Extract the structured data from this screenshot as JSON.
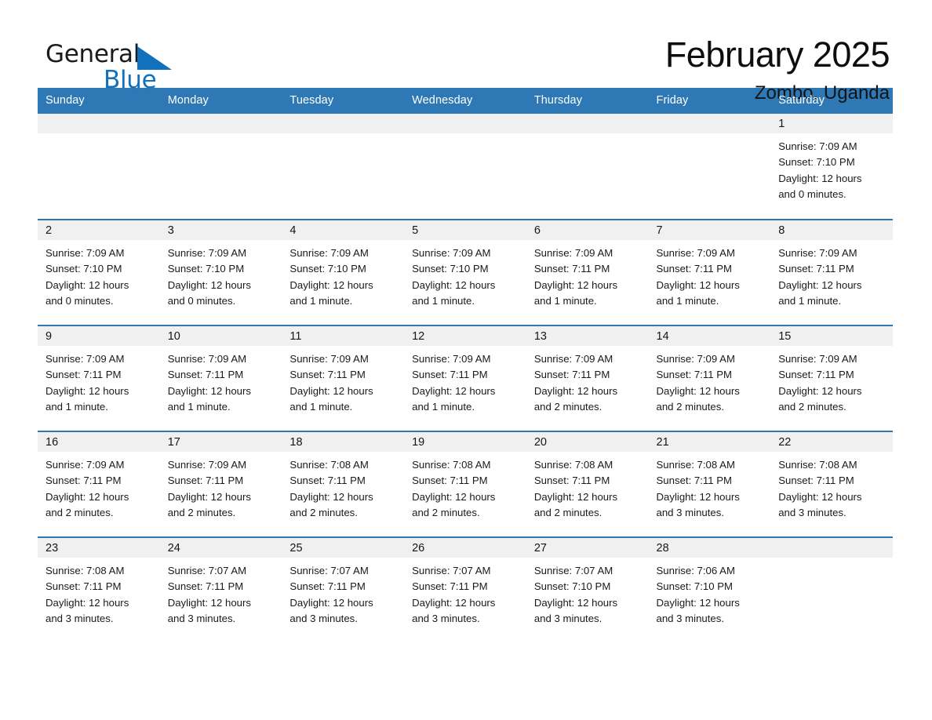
{
  "brand": {
    "name_part1": "General",
    "name_part2": "Blue",
    "triangle_color": "#1271ba"
  },
  "header": {
    "title": "February 2025",
    "location": "Zombo, Uganda"
  },
  "theme": {
    "header_blue": "#2e79b5",
    "daynum_band": "#f0f0f0",
    "text": "#1a1a1a"
  },
  "weekday_headers": [
    "Sunday",
    "Monday",
    "Tuesday",
    "Wednesday",
    "Thursday",
    "Friday",
    "Saturday"
  ],
  "weeks": [
    [
      {
        "day": "",
        "sunrise": "",
        "sunset": "",
        "daylight_line1": "",
        "daylight_line2": "",
        "empty": true
      },
      {
        "day": "",
        "sunrise": "",
        "sunset": "",
        "daylight_line1": "",
        "daylight_line2": "",
        "empty": true
      },
      {
        "day": "",
        "sunrise": "",
        "sunset": "",
        "daylight_line1": "",
        "daylight_line2": "",
        "empty": true
      },
      {
        "day": "",
        "sunrise": "",
        "sunset": "",
        "daylight_line1": "",
        "daylight_line2": "",
        "empty": true
      },
      {
        "day": "",
        "sunrise": "",
        "sunset": "",
        "daylight_line1": "",
        "daylight_line2": "",
        "empty": true
      },
      {
        "day": "",
        "sunrise": "",
        "sunset": "",
        "daylight_line1": "",
        "daylight_line2": "",
        "empty": true
      },
      {
        "day": "1",
        "sunrise": "Sunrise: 7:09 AM",
        "sunset": "Sunset: 7:10 PM",
        "daylight_line1": "Daylight: 12 hours",
        "daylight_line2": "and 0 minutes.",
        "empty": false
      }
    ],
    [
      {
        "day": "2",
        "sunrise": "Sunrise: 7:09 AM",
        "sunset": "Sunset: 7:10 PM",
        "daylight_line1": "Daylight: 12 hours",
        "daylight_line2": "and 0 minutes.",
        "empty": false
      },
      {
        "day": "3",
        "sunrise": "Sunrise: 7:09 AM",
        "sunset": "Sunset: 7:10 PM",
        "daylight_line1": "Daylight: 12 hours",
        "daylight_line2": "and 0 minutes.",
        "empty": false
      },
      {
        "day": "4",
        "sunrise": "Sunrise: 7:09 AM",
        "sunset": "Sunset: 7:10 PM",
        "daylight_line1": "Daylight: 12 hours",
        "daylight_line2": "and 1 minute.",
        "empty": false
      },
      {
        "day": "5",
        "sunrise": "Sunrise: 7:09 AM",
        "sunset": "Sunset: 7:10 PM",
        "daylight_line1": "Daylight: 12 hours",
        "daylight_line2": "and 1 minute.",
        "empty": false
      },
      {
        "day": "6",
        "sunrise": "Sunrise: 7:09 AM",
        "sunset": "Sunset: 7:11 PM",
        "daylight_line1": "Daylight: 12 hours",
        "daylight_line2": "and 1 minute.",
        "empty": false
      },
      {
        "day": "7",
        "sunrise": "Sunrise: 7:09 AM",
        "sunset": "Sunset: 7:11 PM",
        "daylight_line1": "Daylight: 12 hours",
        "daylight_line2": "and 1 minute.",
        "empty": false
      },
      {
        "day": "8",
        "sunrise": "Sunrise: 7:09 AM",
        "sunset": "Sunset: 7:11 PM",
        "daylight_line1": "Daylight: 12 hours",
        "daylight_line2": "and 1 minute.",
        "empty": false
      }
    ],
    [
      {
        "day": "9",
        "sunrise": "Sunrise: 7:09 AM",
        "sunset": "Sunset: 7:11 PM",
        "daylight_line1": "Daylight: 12 hours",
        "daylight_line2": "and 1 minute.",
        "empty": false
      },
      {
        "day": "10",
        "sunrise": "Sunrise: 7:09 AM",
        "sunset": "Sunset: 7:11 PM",
        "daylight_line1": "Daylight: 12 hours",
        "daylight_line2": "and 1 minute.",
        "empty": false
      },
      {
        "day": "11",
        "sunrise": "Sunrise: 7:09 AM",
        "sunset": "Sunset: 7:11 PM",
        "daylight_line1": "Daylight: 12 hours",
        "daylight_line2": "and 1 minute.",
        "empty": false
      },
      {
        "day": "12",
        "sunrise": "Sunrise: 7:09 AM",
        "sunset": "Sunset: 7:11 PM",
        "daylight_line1": "Daylight: 12 hours",
        "daylight_line2": "and 1 minute.",
        "empty": false
      },
      {
        "day": "13",
        "sunrise": "Sunrise: 7:09 AM",
        "sunset": "Sunset: 7:11 PM",
        "daylight_line1": "Daylight: 12 hours",
        "daylight_line2": "and 2 minutes.",
        "empty": false
      },
      {
        "day": "14",
        "sunrise": "Sunrise: 7:09 AM",
        "sunset": "Sunset: 7:11 PM",
        "daylight_line1": "Daylight: 12 hours",
        "daylight_line2": "and 2 minutes.",
        "empty": false
      },
      {
        "day": "15",
        "sunrise": "Sunrise: 7:09 AM",
        "sunset": "Sunset: 7:11 PM",
        "daylight_line1": "Daylight: 12 hours",
        "daylight_line2": "and 2 minutes.",
        "empty": false
      }
    ],
    [
      {
        "day": "16",
        "sunrise": "Sunrise: 7:09 AM",
        "sunset": "Sunset: 7:11 PM",
        "daylight_line1": "Daylight: 12 hours",
        "daylight_line2": "and 2 minutes.",
        "empty": false
      },
      {
        "day": "17",
        "sunrise": "Sunrise: 7:09 AM",
        "sunset": "Sunset: 7:11 PM",
        "daylight_line1": "Daylight: 12 hours",
        "daylight_line2": "and 2 minutes.",
        "empty": false
      },
      {
        "day": "18",
        "sunrise": "Sunrise: 7:08 AM",
        "sunset": "Sunset: 7:11 PM",
        "daylight_line1": "Daylight: 12 hours",
        "daylight_line2": "and 2 minutes.",
        "empty": false
      },
      {
        "day": "19",
        "sunrise": "Sunrise: 7:08 AM",
        "sunset": "Sunset: 7:11 PM",
        "daylight_line1": "Daylight: 12 hours",
        "daylight_line2": "and 2 minutes.",
        "empty": false
      },
      {
        "day": "20",
        "sunrise": "Sunrise: 7:08 AM",
        "sunset": "Sunset: 7:11 PM",
        "daylight_line1": "Daylight: 12 hours",
        "daylight_line2": "and 2 minutes.",
        "empty": false
      },
      {
        "day": "21",
        "sunrise": "Sunrise: 7:08 AM",
        "sunset": "Sunset: 7:11 PM",
        "daylight_line1": "Daylight: 12 hours",
        "daylight_line2": "and 3 minutes.",
        "empty": false
      },
      {
        "day": "22",
        "sunrise": "Sunrise: 7:08 AM",
        "sunset": "Sunset: 7:11 PM",
        "daylight_line1": "Daylight: 12 hours",
        "daylight_line2": "and 3 minutes.",
        "empty": false
      }
    ],
    [
      {
        "day": "23",
        "sunrise": "Sunrise: 7:08 AM",
        "sunset": "Sunset: 7:11 PM",
        "daylight_line1": "Daylight: 12 hours",
        "daylight_line2": "and 3 minutes.",
        "empty": false
      },
      {
        "day": "24",
        "sunrise": "Sunrise: 7:07 AM",
        "sunset": "Sunset: 7:11 PM",
        "daylight_line1": "Daylight: 12 hours",
        "daylight_line2": "and 3 minutes.",
        "empty": false
      },
      {
        "day": "25",
        "sunrise": "Sunrise: 7:07 AM",
        "sunset": "Sunset: 7:11 PM",
        "daylight_line1": "Daylight: 12 hours",
        "daylight_line2": "and 3 minutes.",
        "empty": false
      },
      {
        "day": "26",
        "sunrise": "Sunrise: 7:07 AM",
        "sunset": "Sunset: 7:11 PM",
        "daylight_line1": "Daylight: 12 hours",
        "daylight_line2": "and 3 minutes.",
        "empty": false
      },
      {
        "day": "27",
        "sunrise": "Sunrise: 7:07 AM",
        "sunset": "Sunset: 7:10 PM",
        "daylight_line1": "Daylight: 12 hours",
        "daylight_line2": "and 3 minutes.",
        "empty": false
      },
      {
        "day": "28",
        "sunrise": "Sunrise: 7:06 AM",
        "sunset": "Sunset: 7:10 PM",
        "daylight_line1": "Daylight: 12 hours",
        "daylight_line2": "and 3 minutes.",
        "empty": false
      },
      {
        "day": "",
        "sunrise": "",
        "sunset": "",
        "daylight_line1": "",
        "daylight_line2": "",
        "empty": true
      }
    ]
  ]
}
